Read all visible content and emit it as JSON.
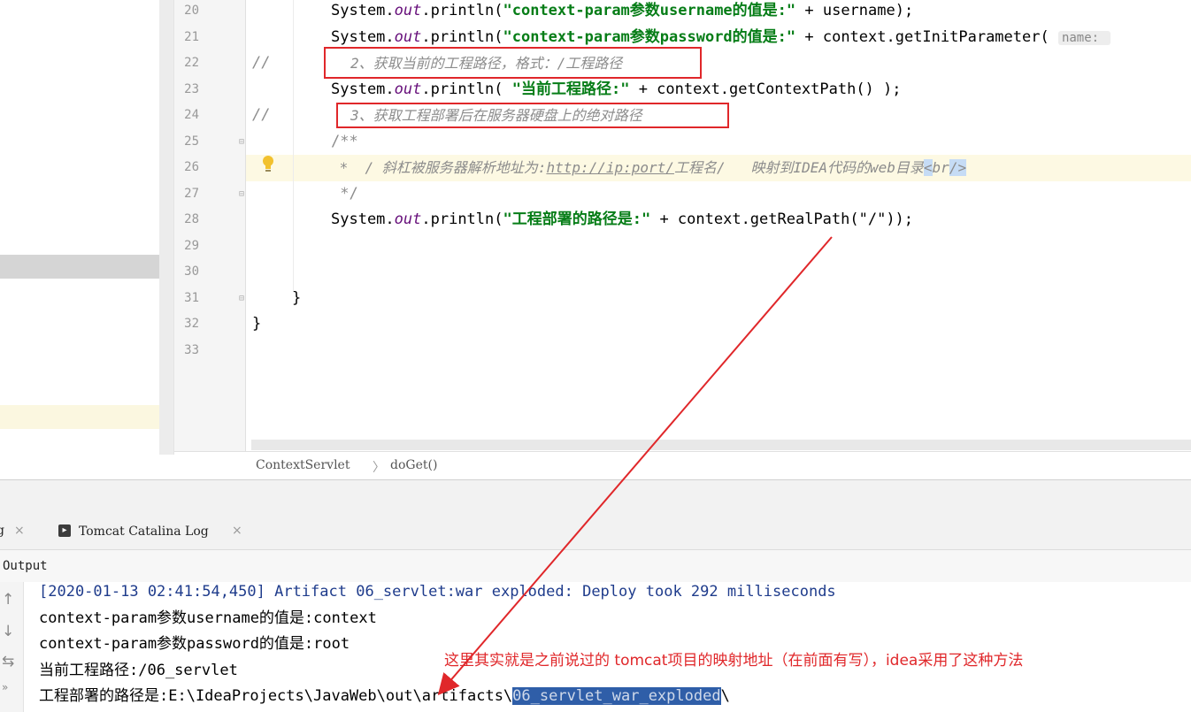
{
  "editor": {
    "line_numbers": [
      "20",
      "21",
      "22",
      "23",
      "24",
      "25",
      "26",
      "27",
      "28",
      "29",
      "30",
      "31",
      "32",
      "33"
    ],
    "lines": {
      "l20_a": "System.",
      "l20_out": "out",
      "l20_b": ".println(",
      "l20_str": "\"context-param参数username的值是:\"",
      "l20_c": " + username);",
      "l21_a": "System.",
      "l21_out": "out",
      "l21_b": ".println(",
      "l21_str": "\"context-param参数password的值是:\"",
      "l21_c": " + context.getInitParameter( ",
      "l21_hint": "name: ",
      "l22_slash": "//",
      "l22_cmt": "2、获取当前的工程路径，格式：/工程路径",
      "l23_a": "System.",
      "l23_out": "out",
      "l23_b": ".println( ",
      "l23_str": "\"当前工程路径:\"",
      "l23_c": " + context.getContextPath() );",
      "l24_slash": "//",
      "l24_cmt": "3、获取工程部署后在服务器硬盘上的绝对路径",
      "l25": "/**",
      "l26_a": " *  / 斜杠被服务器解析地址为:",
      "l26_link": "http://ip:port/",
      "l26_b": "工程名/   映射到IDEA代码的web目录",
      "l26_lt": "<",
      "l26_br": "br",
      "l26_gt": "/>",
      "l27": " */",
      "l28_a": "System.",
      "l28_out": "out",
      "l28_b": ".println(",
      "l28_str": "\"工程部署的路径是:\"",
      "l28_c": " + context.getRealPath(\"/\"));",
      "l31": "}",
      "l32": "}"
    }
  },
  "breadcrumb": {
    "class_name": "ContextServlet",
    "separator": "〉",
    "method_name": "doGet()"
  },
  "tool_window": {
    "prev_tab_fragment": "g",
    "tab_close": "×",
    "tab_label": "Tomcat Catalina Log",
    "output_label": "Output"
  },
  "console": {
    "line1": "[2020-01-13 02:41:54,450] Artifact 06_servlet:war exploded: Deploy took 292 milliseconds",
    "line2": "context-param参数username的值是:context",
    "line3": "context-param参数password的值是:root",
    "line4": "当前工程路径:/06_servlet",
    "line5_prefix": "工程部署的路径是:E:\\IdeaProjects\\JavaWeb\\out\\artifacts\\",
    "line5_selected": "06_servlet_war_exploded",
    "line5_suffix": "\\"
  },
  "annotation": "这里其实就是之前说过的 tomcat项目的映射地址（在前面有写），idea采用了这种方法",
  "colors": {
    "annotation_red": "#e0272a",
    "string_green": "#067d17",
    "console_blue": "#1f3c8c"
  }
}
